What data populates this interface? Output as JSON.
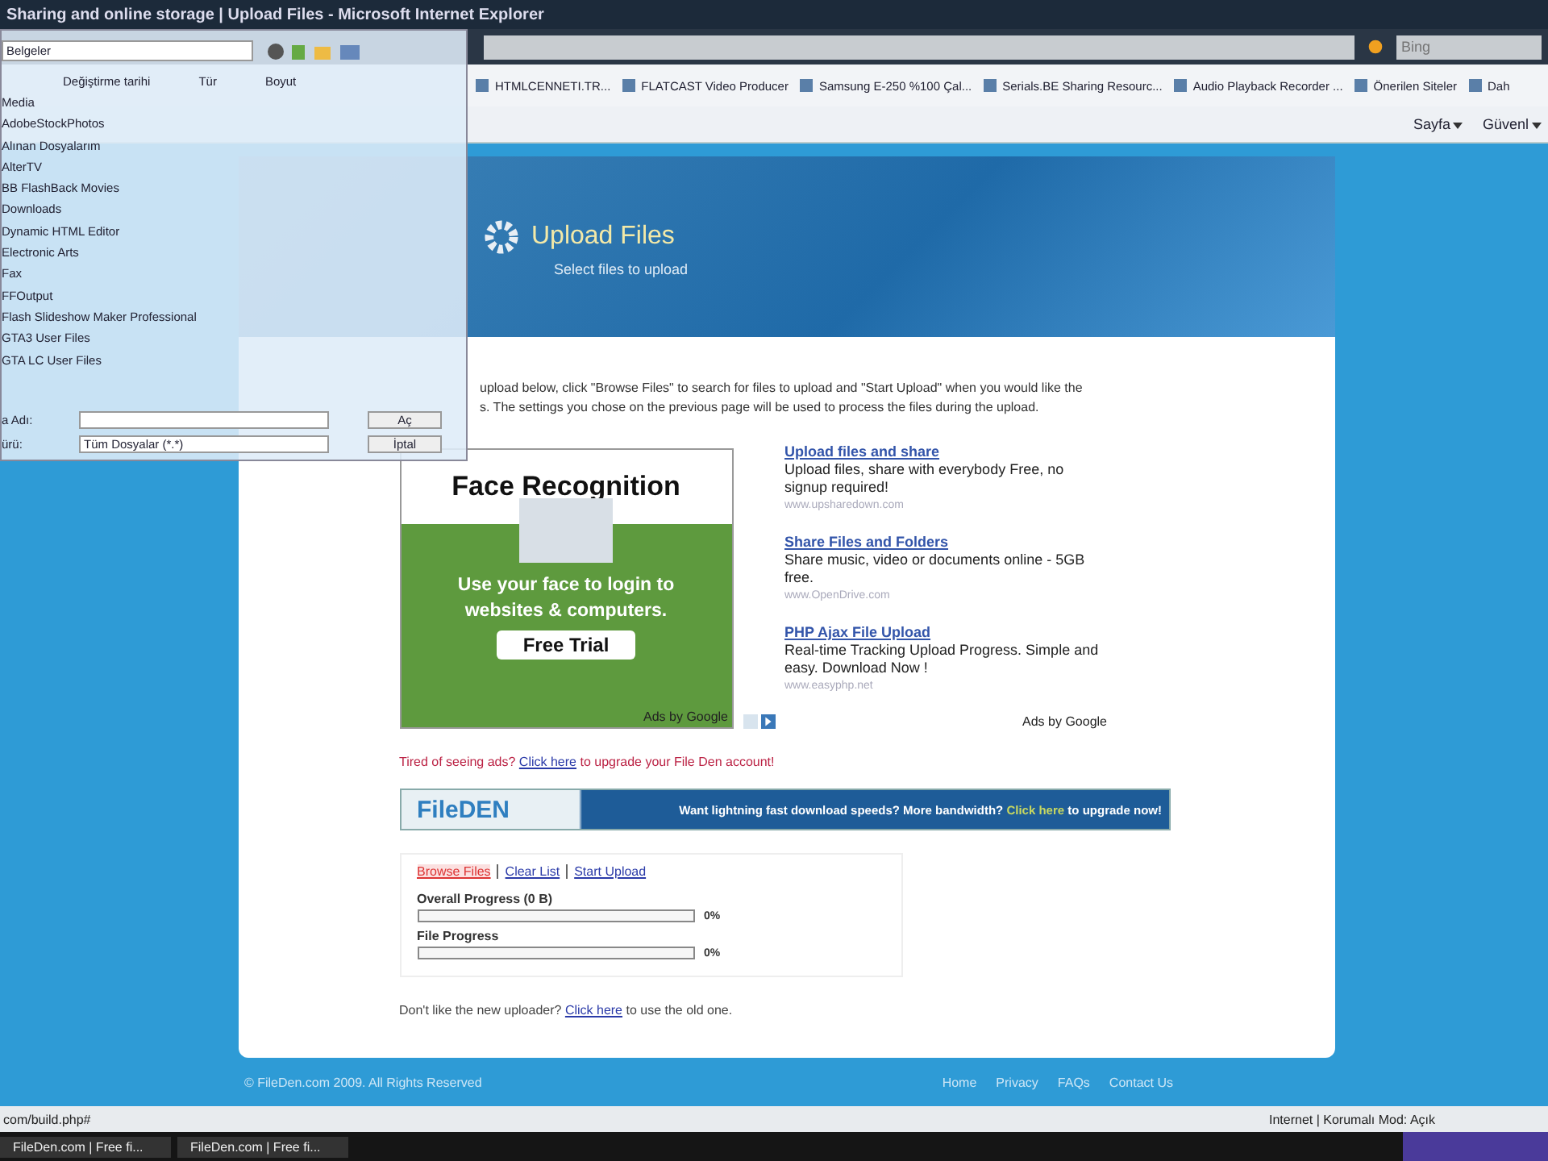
{
  "window": {
    "title": "Sharing and online storage | Upload Files - Microsoft Internet Explorer"
  },
  "search": {
    "placeholder": "Bing"
  },
  "favorites": [
    "HTMLCENNETI.TR...",
    "FLATCAST Video Producer",
    "Samsung E-250 %100 Çal...",
    "Serials.BE Sharing Resourc...",
    "Audio Playback Recorder ...",
    "Önerilen Siteler",
    "Dah"
  ],
  "command_bar": [
    "Sayfa",
    "Güvenl"
  ],
  "header": {
    "title": "Upload Files",
    "subtitle": "Select files to upload"
  },
  "intro": [
    "upload below, click \"Browse Files\" to search for files to upload and \"Start Upload\" when you would like the",
    "s. The settings you chose on the previous page will be used to process the files during the upload."
  ],
  "image_ad": {
    "title": "Face Recognition",
    "text": "Use your face to login to websites & computers.",
    "button": "Free Trial",
    "credit": "Ads by Google"
  },
  "text_ads": [
    {
      "title": "Upload files and share",
      "text": "Upload files, share with everybody Free, no signup required!",
      "url": "www.upsharedown.com"
    },
    {
      "title": "Share Files and Folders",
      "text": "Share music, video or documents online - 5GB free.",
      "url": "www.OpenDrive.com"
    },
    {
      "title": "PHP Ajax File Upload",
      "text": "Real-time Tracking Upload Progress. Simple and easy. Download Now !",
      "url": "www.easyphp.net"
    }
  ],
  "text_ads_credit": "Ads by Google",
  "upgrade_note": {
    "before": "Tired of seeing ads?",
    "link": "Click here",
    "after": "to upgrade your File Den account!"
  },
  "promo": {
    "logo": "FileDEN",
    "before": "Want lightning fast download speeds? More bandwidth?",
    "link": "Click here",
    "after": "to upgrade now!"
  },
  "uploader": {
    "actions": [
      {
        "label": "Browse Files",
        "selected": true
      },
      {
        "label": "Clear List",
        "selected": false
      },
      {
        "label": "Start Upload",
        "selected": false
      }
    ],
    "progress": [
      {
        "label": "Overall Progress (0 B)",
        "level": 0,
        "reading": "0%"
      },
      {
        "label": "File Progress",
        "level": 0,
        "reading": "0%"
      }
    ]
  },
  "old_uploader": {
    "before": "Don't like the new uploader?",
    "link": "Click here",
    "after": "to use the old one."
  },
  "footer": {
    "copyright": "© FileDen.com 2009. All Rights Reserved",
    "links": [
      "Home",
      "Privacy",
      "FAQs",
      "Contact Us"
    ]
  },
  "status_bar": {
    "url": "com/build.php#",
    "zone": "Internet | Korumalı Mod: Açık"
  },
  "taskbar": {
    "tasks": [
      "FileDen.com | Free fi...",
      "FileDen.com | Free fi..."
    ]
  },
  "file_dialog": {
    "location": "Belgeler",
    "columns": [
      "Değiştirme tarihi",
      "Tür",
      "Boyut"
    ],
    "items": [
      "Media",
      "AdobeStockPhotos",
      "Alınan Dosyalarım",
      "AlterTV",
      "BB FlashBack Movies",
      "Downloads",
      "Dynamic HTML Editor",
      "Electronic Arts",
      "Fax",
      "FFOutput",
      "Flash Slideshow Maker Professional",
      "GTA3 User Files",
      "GTA LC User Files"
    ],
    "name_label": "a Adı:",
    "type_label": "ürü:",
    "type_value": "Tüm Dosyalar (*.*)",
    "open_button": "Aç",
    "cancel_button": "İptal"
  }
}
